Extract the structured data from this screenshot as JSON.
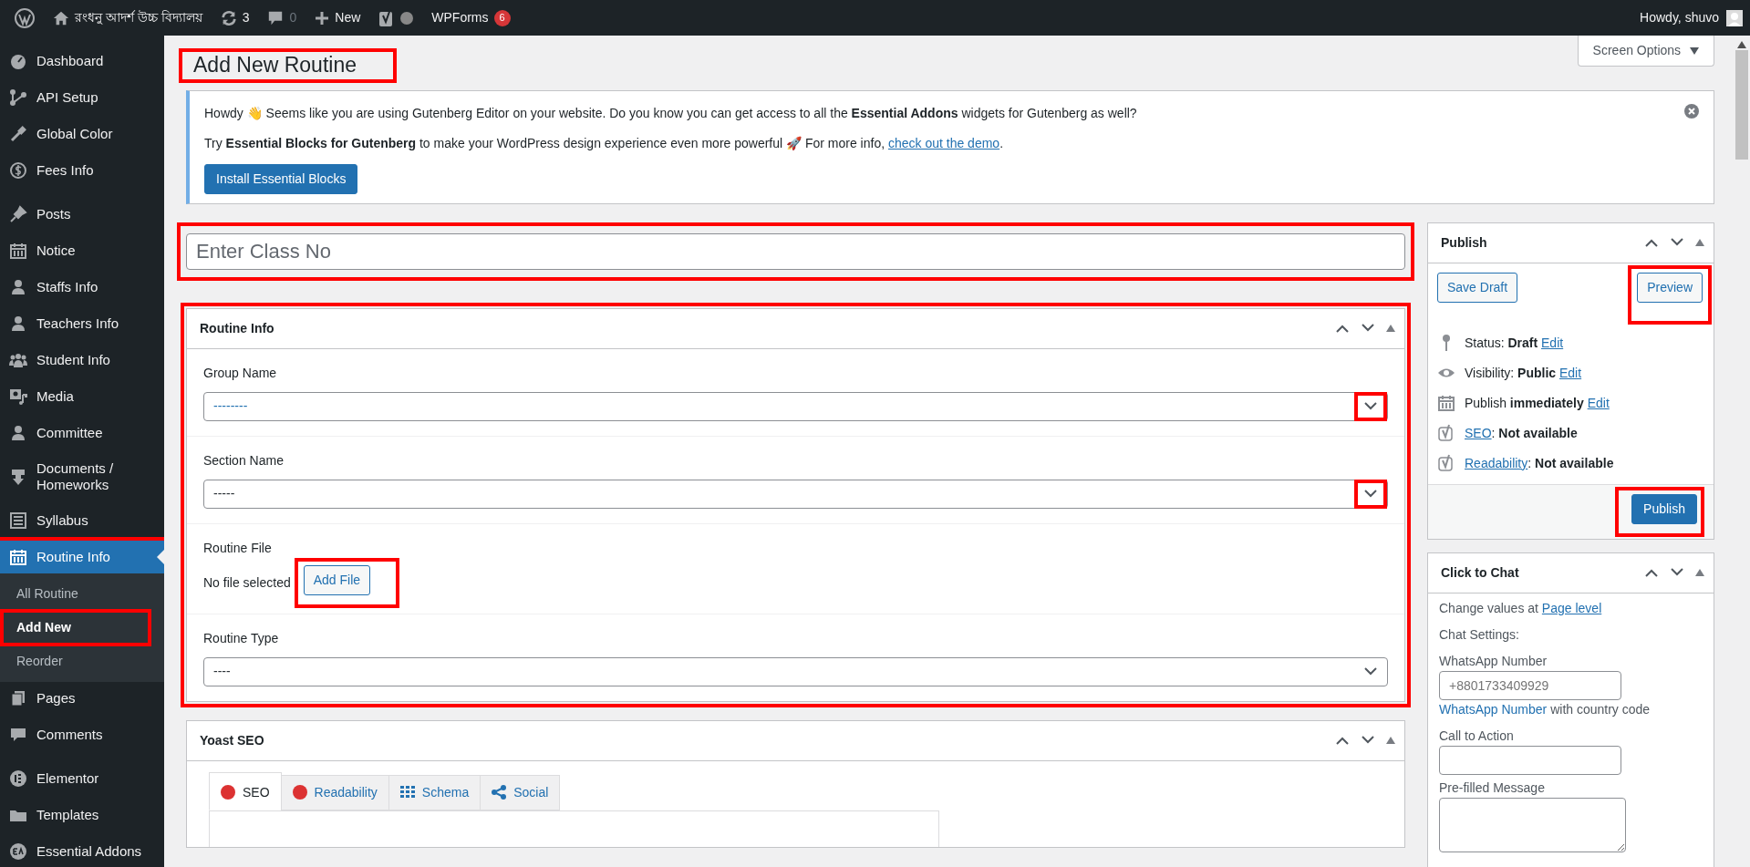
{
  "admin_bar": {
    "site_name": "রংধনু আদর্শ উচ্চ বিদ্যালয়",
    "updates": "3",
    "comments": "0",
    "new_label": "New",
    "wpforms_label": "WPForms",
    "wpforms_count": "6",
    "greeting": "Howdy, shuvo"
  },
  "sidebar": {
    "groups": [
      [
        {
          "label": "Dashboard",
          "selected": false,
          "highlighted": false
        },
        {
          "label": "API Setup",
          "selected": false,
          "highlighted": false
        },
        {
          "label": "Global Color",
          "selected": false,
          "highlighted": false
        },
        {
          "label": "Fees Info",
          "selected": false,
          "highlighted": false
        }
      ],
      [
        {
          "label": "Posts",
          "selected": false,
          "highlighted": false
        },
        {
          "label": "Notice",
          "selected": false,
          "highlighted": false
        },
        {
          "label": "Staffs Info",
          "selected": false,
          "highlighted": false
        },
        {
          "label": "Teachers Info",
          "selected": false,
          "highlighted": false
        },
        {
          "label": "Student Info",
          "selected": false,
          "highlighted": false
        },
        {
          "label": "Media",
          "selected": false,
          "highlighted": false
        },
        {
          "label": "Committee",
          "selected": false,
          "highlighted": false
        },
        {
          "label": "Documents / Homeworks",
          "selected": false,
          "highlighted": false
        },
        {
          "label": "Syllabus",
          "selected": false,
          "highlighted": false
        },
        {
          "label": "Routine Info",
          "selected": true,
          "highlighted": true,
          "children": [
            {
              "label": "All Routine",
              "selected": false,
              "highlighted": false
            },
            {
              "label": "Add New",
              "selected": true,
              "highlighted": true
            },
            {
              "label": "Reorder",
              "selected": false,
              "highlighted": false
            }
          ]
        },
        {
          "label": "Pages",
          "selected": false,
          "highlighted": false
        },
        {
          "label": "Comments",
          "selected": false,
          "highlighted": false
        }
      ],
      [
        {
          "label": "Elementor",
          "selected": false,
          "highlighted": false
        },
        {
          "label": "Templates",
          "selected": false,
          "highlighted": false
        },
        {
          "label": "Essential Addons",
          "selected": false,
          "highlighted": false
        }
      ]
    ]
  },
  "screen_options": "Screen Options",
  "page_title": {
    "text": "Add New Routine",
    "highlighted": true
  },
  "notice": {
    "line_1": "Howdy 👋 Seems like you are using Gutenberg Editor on your website. Do you know you can get access to all the **Essential Addons** widgets for Gutenberg as well?",
    "line_2": "Try **Essential Blocks for Gutenberg** to make your WordPress design experience even more powerful 🚀 For more info,",
    "link": "check out the demo",
    "line_2_end": ".",
    "button": "Install Essential Blocks"
  },
  "title_field": {
    "placeholder": "Enter Class No",
    "highlighted": true
  },
  "routine_box": {
    "title": "Routine Info",
    "highlighted": true,
    "fields": [
      {
        "kind": "select",
        "label": "Group Name",
        "value": "--------",
        "focused": true,
        "highlighted": true
      },
      {
        "kind": "select",
        "label": "Section Name",
        "value": "-----",
        "focused": false,
        "highlighted": true
      },
      {
        "kind": "file",
        "label": "Routine File",
        "status": "No file selected",
        "button": "Add File",
        "highlighted": true
      },
      {
        "kind": "select",
        "label": "Routine Type",
        "value": "----",
        "focused": false,
        "highlighted": false
      }
    ]
  },
  "yoast_box": {
    "title": "Yoast SEO",
    "tabs": [
      {
        "label": "SEO",
        "kind": "dot",
        "color": "#dc3232",
        "selected": true
      },
      {
        "label": "Readability",
        "kind": "dot",
        "color": "#dc3232",
        "selected": false
      },
      {
        "label": "Schema",
        "kind": "grid",
        "selected": false
      },
      {
        "label": "Social",
        "kind": "share",
        "selected": false
      }
    ]
  },
  "publish_box": {
    "title": "Publish",
    "save_draft": "Save Draft",
    "preview": {
      "label": "Preview",
      "highlighted": true
    },
    "rows": [
      {
        "kind": "pin",
        "before": "Status: **Draft**",
        "link": "Edit"
      },
      {
        "kind": "eye",
        "before": "Visibility: **Public**",
        "link": "Edit"
      },
      {
        "kind": "calendar",
        "before": "Publish **immediately**",
        "link": "Edit"
      },
      {
        "kind": "yoast",
        "link": "SEO",
        "after": ": **Not available**"
      },
      {
        "kind": "yoast",
        "link": "Readability",
        "after": ": **Not available**"
      }
    ],
    "publish": {
      "label": "Publish",
      "highlighted": true
    }
  },
  "chat_box": {
    "title": "Click to Chat",
    "change_text": "Change values at",
    "change_link": "Page level",
    "settings_label": "Chat Settings:",
    "number_label": "WhatsApp Number",
    "number_placeholder": "+8801733409929",
    "number_hint_link": "WhatsApp Number",
    "number_hint": "with country code",
    "cta_label": "Call to Action",
    "message_label": "Pre-filled Message"
  }
}
